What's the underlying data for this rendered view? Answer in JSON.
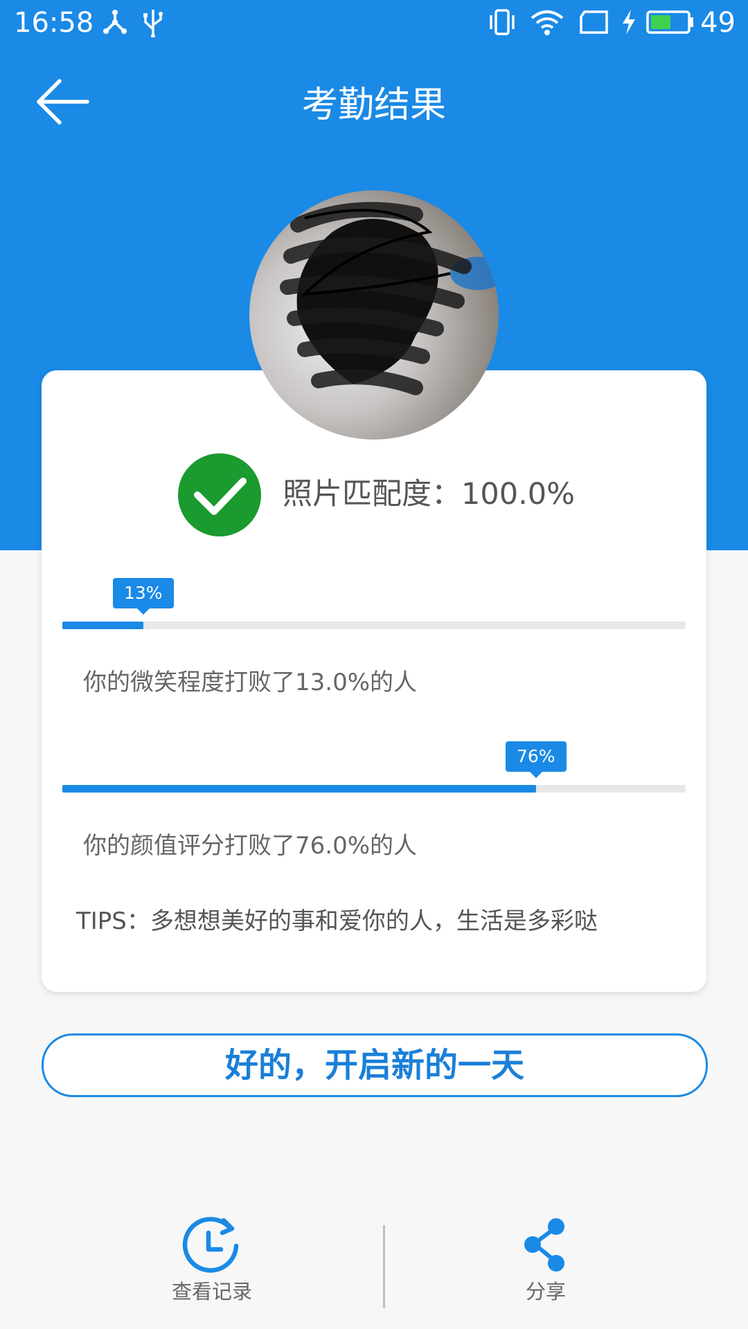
{
  "status_bar": {
    "time": "16:58",
    "battery_level": "49",
    "icons": [
      "share-nodes-icon",
      "usb-icon",
      "vibrate-icon",
      "wifi-icon",
      "tablet-icon",
      "charging-icon",
      "battery-icon"
    ]
  },
  "nav": {
    "title": "考勤结果",
    "back_icon": "arrow-left-icon"
  },
  "result": {
    "match_label": "照片匹配度：100.0%",
    "match_icon": "checkmark-icon",
    "smile": {
      "tip": "13%",
      "fraction": 0.13,
      "text": "你的微笑程度打败了13.0%的人"
    },
    "appearance": {
      "tip": "76%",
      "fraction": 0.76,
      "text": "你的颜值评分打败了76.0%的人"
    },
    "tips": "TIPS：多想想美好的事和爱你的人，生活是多彩哒"
  },
  "start_button": "好的，开启新的一天",
  "bottom": {
    "history_label": "查看记录",
    "history_icon": "clock-history-icon",
    "share_label": "分享",
    "share_icon": "share-icon"
  },
  "colors": {
    "primary": "#1a8ae6",
    "success": "#1a9a2f",
    "background": "#f7f7f7"
  }
}
